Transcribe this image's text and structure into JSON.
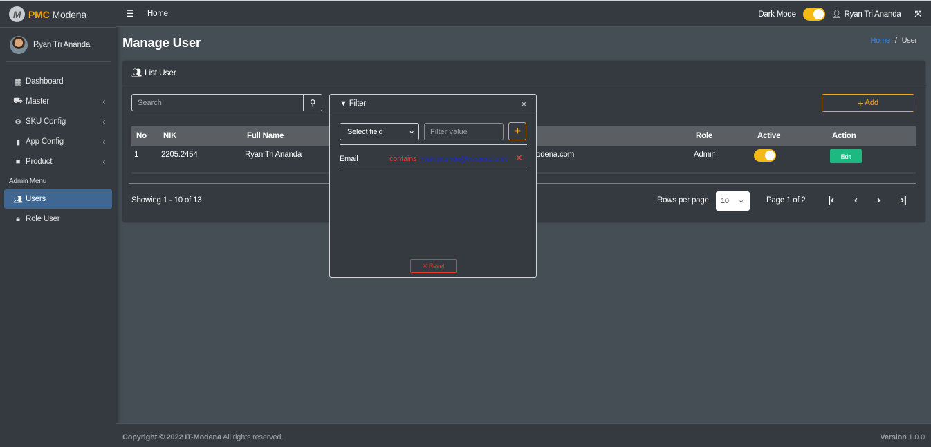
{
  "brand": {
    "logo_letter": "M",
    "prefix": "PMC",
    "name": "Modena"
  },
  "sidebar": {
    "user_name": "Ryan Tri Ananda",
    "items": [
      {
        "label": "Dashboard",
        "icon": "grid-icon"
      },
      {
        "label": "Master",
        "icon": "car-icon"
      },
      {
        "label": "SKU Config",
        "icon": "gear-icon"
      },
      {
        "label": "App Config",
        "icon": "mobile-icon"
      },
      {
        "label": "Product",
        "icon": "briefcase-icon"
      }
    ],
    "section_header": "Admin Menu",
    "admin_items": [
      {
        "label": "Users",
        "icon": "users-icon",
        "active": true
      },
      {
        "label": "Role User",
        "icon": "lock-icon"
      }
    ]
  },
  "topbar": {
    "home": "Home",
    "dark_mode_label": "Dark Mode",
    "dark_mode_on": true,
    "user_name": "Ryan Tri Ananda"
  },
  "page": {
    "title": "Manage User",
    "breadcrumb_home": "Home",
    "breadcrumb_sep": "/",
    "breadcrumb_current": "User"
  },
  "card": {
    "header": "List User",
    "search_placeholder": "Search",
    "add_label": "Add"
  },
  "table": {
    "columns": {
      "no": "No",
      "nik": "NIK",
      "full_name": "Full Name",
      "role": "Role",
      "active": "Active",
      "action": "Action"
    },
    "rows": [
      {
        "no": "1",
        "nik": "2205.2454",
        "full_name": "Ryan Tri Ananda",
        "email_visible": "odena.com",
        "role": "Admin",
        "active": true,
        "action_label": "Edit"
      }
    ]
  },
  "pagination": {
    "showing": "Showing 1 - 10 of 13",
    "rows_per_page_label": "Rows per page",
    "rows_per_page": "10",
    "page_info": "Page 1 of 2"
  },
  "filter_modal": {
    "title": "Filter",
    "select_placeholder": "Select field",
    "value_placeholder": "Filter value",
    "active_filters": [
      {
        "field": "Email",
        "operator": "contains",
        "value": "ryan.ananda@modena.com"
      }
    ],
    "reset_label": "Reset"
  },
  "footer": {
    "copyright": "Copyright © 2022 IT-Modena",
    "rights": " All rights reserved.",
    "version_label": "Version",
    "version": "1.0.0"
  },
  "colors": {
    "accent": "#f5a623",
    "toggle": "#f5b915",
    "edit": "#1eb980",
    "danger": "#e8392f",
    "active_nav": "#3f6791",
    "link": "#3b8fe8"
  }
}
